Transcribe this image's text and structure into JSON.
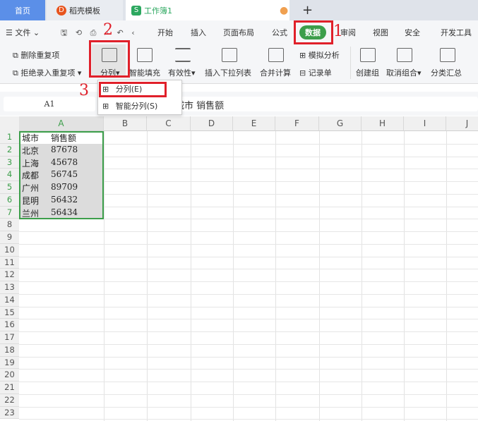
{
  "tabs": {
    "home": "首页",
    "template": "稻壳模板",
    "workbook": "工作簿1",
    "new_tab": "+"
  },
  "menu": {
    "file": "文件",
    "items": [
      "开始",
      "插入",
      "页面布局",
      "公式",
      "数据",
      "审阅",
      "视图",
      "安全",
      "开发工具"
    ],
    "active": "数据"
  },
  "ribbon": {
    "remove_dup": "删除重复项",
    "reject_dup": "拒绝录入重复项",
    "split": "分列",
    "smart_fill": "智能填充",
    "validity": "有效性",
    "insert_dropdown": "插入下拉列表",
    "consolidate": "合并计算",
    "simulate": "模拟分析",
    "record": "记录单",
    "group": "创建组",
    "ungroup": "取消组合",
    "subtotal": "分类汇总"
  },
  "dropdown": {
    "items": [
      "分列(E)",
      "智能分列(S)"
    ]
  },
  "formula": {
    "namebox": "A1",
    "content": "城市   销售额"
  },
  "columns": [
    "A",
    "B",
    "C",
    "D",
    "E",
    "F",
    "G",
    "H",
    "I",
    "J"
  ],
  "rows": [
    "1",
    "2",
    "3",
    "4",
    "5",
    "6",
    "7",
    "8",
    "9",
    "10",
    "11",
    "12",
    "13",
    "14",
    "15",
    "16",
    "17",
    "18",
    "19",
    "20",
    "21",
    "22",
    "23"
  ],
  "cells": [
    [
      "城市",
      "销售额"
    ],
    [
      "北京",
      "87678"
    ],
    [
      "上海",
      "45678"
    ],
    [
      "成都",
      "56745"
    ],
    [
      "广州",
      "89709"
    ],
    [
      "昆明",
      "56432"
    ],
    [
      "兰州",
      "56434"
    ]
  ],
  "annotations": [
    "1",
    "2",
    "3"
  ],
  "colors": {
    "accent": "#3c9e4a",
    "annotation": "#e0202a",
    "home_tab": "#5b8fe8"
  }
}
